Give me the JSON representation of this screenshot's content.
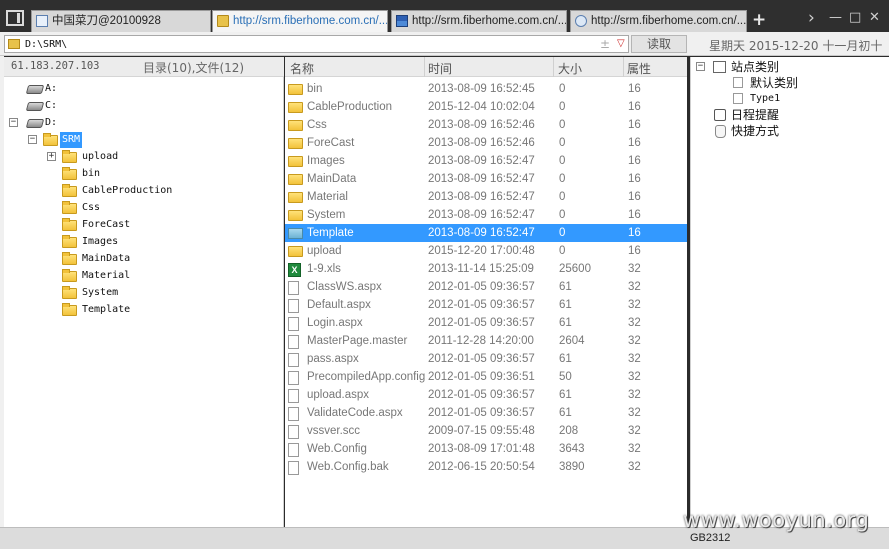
{
  "tabs": [
    {
      "label": "中国菜刀@20100928",
      "icon": "page-icon"
    },
    {
      "label": "http://srm.fiberhome.com.cn/...",
      "icon": "folder-icon",
      "active": true
    },
    {
      "label": "http://srm.fiberhome.com.cn/...",
      "icon": "flag-icon"
    },
    {
      "label": "http://srm.fiberhome.com.cn/...",
      "icon": "globe-icon"
    }
  ],
  "new_tab_label": "+",
  "window_controls": {
    "next": "›",
    "minimize": "—",
    "maximize": "□",
    "close": "✕"
  },
  "address": {
    "path": "D:\\SRM\\",
    "plus": "±",
    "dropdown": "▽",
    "read_button": "读取",
    "date": "星期天 2015-12-20 十一月初十"
  },
  "left": {
    "ip": "61.183.207.103",
    "counts": "目录(10),文件(12)",
    "tree": [
      {
        "label": "A:",
        "type": "drive"
      },
      {
        "label": "C:",
        "type": "drive"
      },
      {
        "label": "D:",
        "type": "drive",
        "expander": "−"
      },
      {
        "label": "SRM",
        "type": "folder",
        "expander": "−",
        "selected": true
      },
      {
        "label": "upload",
        "type": "folder",
        "expander": "+"
      },
      {
        "label": "bin",
        "type": "folder"
      },
      {
        "label": "CableProduction",
        "type": "folder"
      },
      {
        "label": "Css",
        "type": "folder"
      },
      {
        "label": "ForeCast",
        "type": "folder"
      },
      {
        "label": "Images",
        "type": "folder"
      },
      {
        "label": "MainData",
        "type": "folder"
      },
      {
        "label": "Material",
        "type": "folder"
      },
      {
        "label": "System",
        "type": "folder"
      },
      {
        "label": "Template",
        "type": "folder"
      }
    ]
  },
  "list": {
    "columns": {
      "name": "名称",
      "time": "时间",
      "size": "大小",
      "attr": "属性"
    },
    "rows": [
      {
        "name": "bin",
        "time": "2013-08-09 16:52:45",
        "size": "0",
        "attr": "16",
        "type": "folder"
      },
      {
        "name": "CableProduction",
        "time": "2015-12-04 10:02:04",
        "size": "0",
        "attr": "16",
        "type": "folder"
      },
      {
        "name": "Css",
        "time": "2013-08-09 16:52:46",
        "size": "0",
        "attr": "16",
        "type": "folder"
      },
      {
        "name": "ForeCast",
        "time": "2013-08-09 16:52:46",
        "size": "0",
        "attr": "16",
        "type": "folder"
      },
      {
        "name": "Images",
        "time": "2013-08-09 16:52:47",
        "size": "0",
        "attr": "16",
        "type": "folder"
      },
      {
        "name": "MainData",
        "time": "2013-08-09 16:52:47",
        "size": "0",
        "attr": "16",
        "type": "folder"
      },
      {
        "name": "Material",
        "time": "2013-08-09 16:52:47",
        "size": "0",
        "attr": "16",
        "type": "folder"
      },
      {
        "name": "System",
        "time": "2013-08-09 16:52:47",
        "size": "0",
        "attr": "16",
        "type": "folder"
      },
      {
        "name": "Template",
        "time": "2013-08-09 16:52:47",
        "size": "0",
        "attr": "16",
        "type": "folder",
        "selected": true
      },
      {
        "name": "upload",
        "time": "2015-12-20 17:00:48",
        "size": "0",
        "attr": "16",
        "type": "folder"
      },
      {
        "name": "1-9.xls",
        "time": "2013-11-14 15:25:09",
        "size": "25600",
        "attr": "32",
        "type": "excel"
      },
      {
        "name": "ClassWS.aspx",
        "time": "2012-01-05 09:36:57",
        "size": "61",
        "attr": "32",
        "type": "file"
      },
      {
        "name": "Default.aspx",
        "time": "2012-01-05 09:36:57",
        "size": "61",
        "attr": "32",
        "type": "file"
      },
      {
        "name": "Login.aspx",
        "time": "2012-01-05 09:36:57",
        "size": "61",
        "attr": "32",
        "type": "file"
      },
      {
        "name": "MasterPage.master",
        "time": "2011-12-28 14:20:00",
        "size": "2604",
        "attr": "32",
        "type": "file"
      },
      {
        "name": "pass.aspx",
        "time": "2012-01-05 09:36:57",
        "size": "61",
        "attr": "32",
        "type": "file"
      },
      {
        "name": "PrecompiledApp.config",
        "time": "2012-01-05 09:36:51",
        "size": "50",
        "attr": "32",
        "type": "file"
      },
      {
        "name": "upload.aspx",
        "time": "2012-01-05 09:36:57",
        "size": "61",
        "attr": "32",
        "type": "file"
      },
      {
        "name": "ValidateCode.aspx",
        "time": "2012-01-05 09:36:57",
        "size": "61",
        "attr": "32",
        "type": "file"
      },
      {
        "name": "vssver.scc",
        "time": "2009-07-15 09:55:48",
        "size": "208",
        "attr": "32",
        "type": "file"
      },
      {
        "name": "Web.Config",
        "time": "2013-08-09 17:01:48",
        "size": "3643",
        "attr": "32",
        "type": "file"
      },
      {
        "name": "Web.Config.bak",
        "time": "2012-06-15 20:50:54",
        "size": "3890",
        "attr": "32",
        "type": "file"
      }
    ]
  },
  "right": {
    "sites_label": "站点类别",
    "sites_expander": "−",
    "default_category": "默认类别",
    "type1": "Type1",
    "schedule": "日程提醒",
    "shortcuts": "快捷方式"
  },
  "status": {
    "encoding": "GB2312"
  },
  "watermark": "www.wooyun.org",
  "colors": {
    "selection": "#3399ff",
    "folder": "#f2c23a",
    "active_tab_text": "#2a6fb6"
  }
}
